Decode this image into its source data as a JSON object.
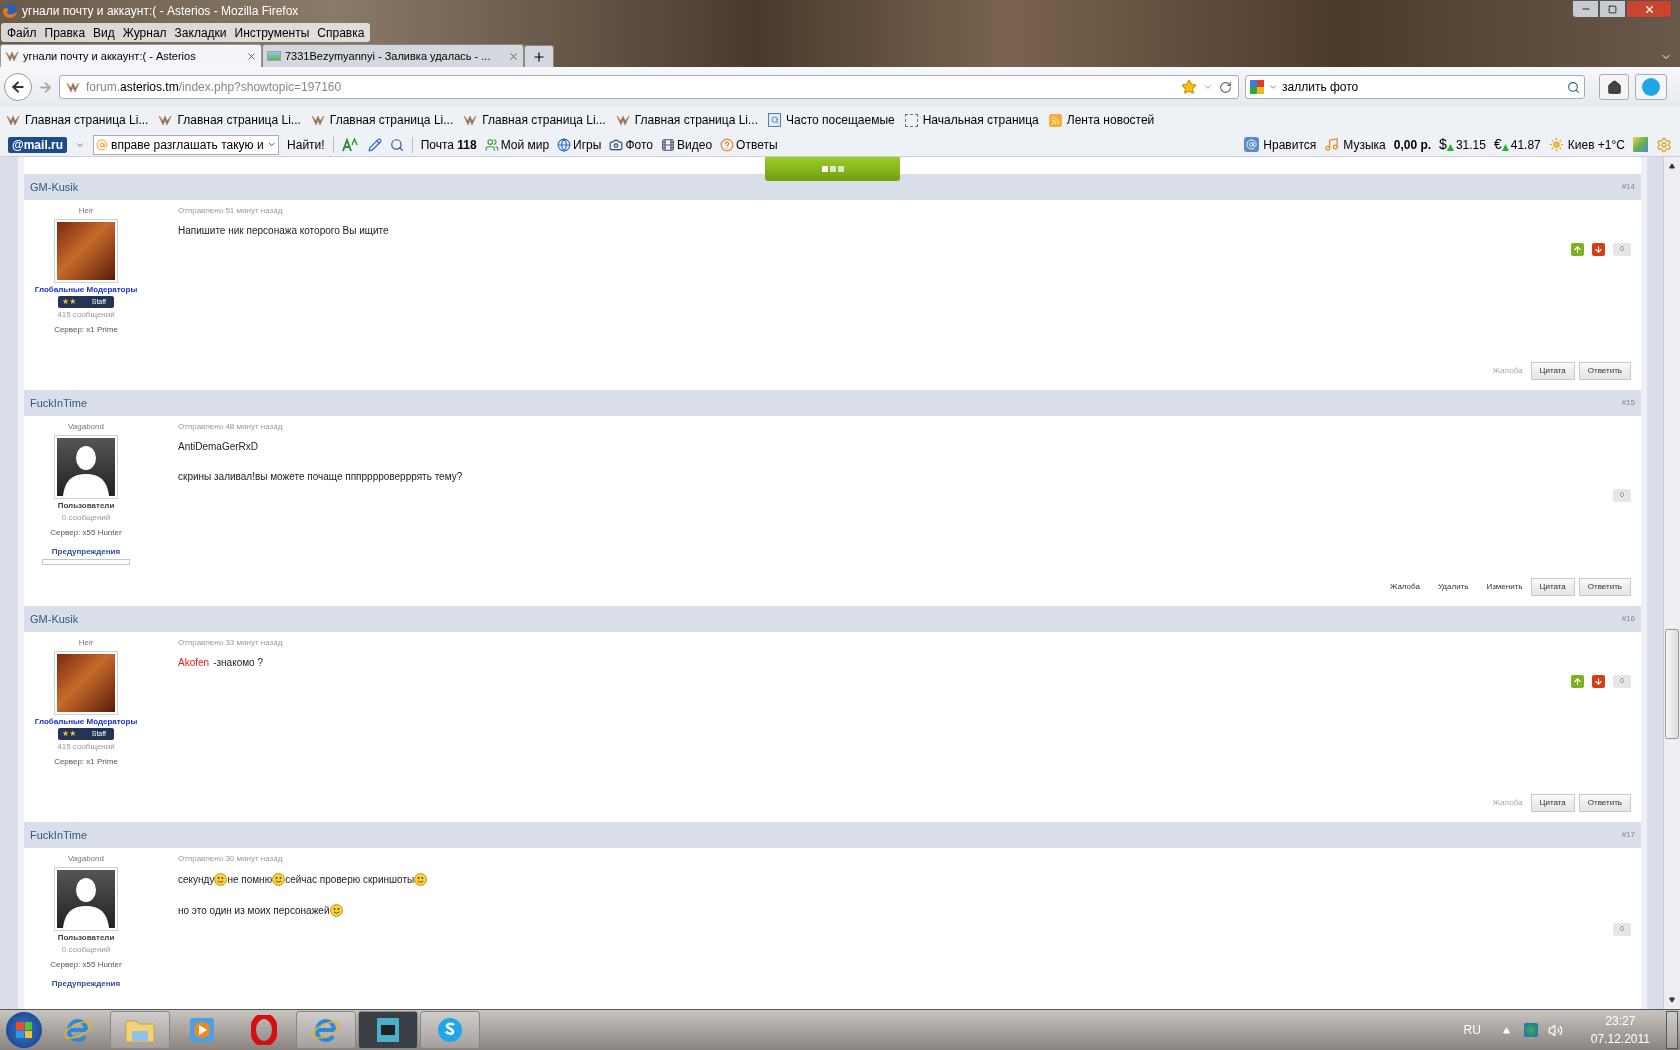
{
  "window": {
    "title": "угнали почту и аккаунт:( - Asterios - Mozilla Firefox"
  },
  "menu": [
    "Файл",
    "Правка",
    "Вид",
    "Журнал",
    "Закладки",
    "Инструменты",
    "Справка"
  ],
  "tabs": [
    {
      "label": "угнали почту и аккаунт:( - Asterios",
      "selected": true
    },
    {
      "label": "7331Bezymyannyi - Заливка удалась - ...",
      "selected": false
    }
  ],
  "address": {
    "value": "forum.**asterios.tm**/index.php?showtopic=197160"
  },
  "search": {
    "value": "заллить фото"
  },
  "bookmarks": [
    {
      "kind": "site",
      "label": "Главная страница Li..."
    },
    {
      "kind": "site",
      "label": "Главная страница Li..."
    },
    {
      "kind": "site",
      "label": "Главная страница Li..."
    },
    {
      "kind": "site",
      "label": "Главная страница Li..."
    },
    {
      "kind": "site",
      "label": "Главная страница Li..."
    },
    {
      "kind": "frequent",
      "label": "Часто посещаемые"
    },
    {
      "kind": "blank",
      "label": "Начальная страница"
    },
    {
      "kind": "feed",
      "label": "Лента новостей"
    }
  ],
  "mail_toolbar": {
    "logo": "@mail.ru",
    "search_value": "вправе разглашать такую и",
    "find_button": "Найти!",
    "links": [
      {
        "kind": "mail",
        "label": "Почта **118**"
      },
      {
        "kind": "world",
        "label": "Мой мир"
      },
      {
        "kind": "games",
        "label": "Игры"
      },
      {
        "kind": "photo",
        "label": "Фото"
      },
      {
        "kind": "video",
        "label": "Видео"
      },
      {
        "kind": "answers",
        "label": "Ответы"
      }
    ],
    "widgets": [
      {
        "kind": "like",
        "label": "Нравится"
      },
      {
        "kind": "music",
        "label": "Музыка"
      },
      {
        "kind": "balance",
        "label": "0,00 р."
      },
      {
        "kind": "rate",
        "symbol": "$",
        "label": "31.15"
      },
      {
        "kind": "rate",
        "symbol": "€",
        "label": "41.87"
      },
      {
        "kind": "weather",
        "label": "Киев +1°C"
      }
    ]
  },
  "posts": [
    {
      "author": "GM-Kusik",
      "number": "#14",
      "rank": "Heir",
      "avatar": {
        "kind": "photo"
      },
      "group": {
        "kind": "moderator",
        "text": "Глобальные Модераторы"
      },
      "badge": {
        "marks": "★★",
        "label": "Staff"
      },
      "post_count": "415 сообщений",
      "server": "Сервер: x1 Prime",
      "date": "Отправлено 51 минут назад",
      "lines": [
        [
          {
            "kind": "text",
            "text": "Напишите ник персонажа которого Вы ищите"
          }
        ]
      ],
      "vote_buttons": true,
      "rating": "0",
      "actions": [
        {
          "kind": "link",
          "label": "Жалоба",
          "disabled": true
        },
        {
          "kind": "button",
          "label": "Цитата",
          "disabled": false
        },
        {
          "kind": "button",
          "label": "Ответить",
          "disabled": false
        }
      ]
    },
    {
      "author": "FuckInTime",
      "number": "#15",
      "rank": "Vagabond",
      "avatar": {
        "kind": "silhouette"
      },
      "group": {
        "kind": "user",
        "text": "Пользователи"
      },
      "post_count": "0 сообщений",
      "server": "Сервер: x55 Hunter",
      "warnings": {
        "label": "Предупреждения",
        "level": 0
      },
      "date": "Отправлено 48 минут назад",
      "lines": [
        [
          {
            "kind": "text",
            "text": "AntiDemaGerRxD"
          }
        ],
        [
          {
            "kind": "text",
            "text": "скрины заливал!вы можете почаще пппрррроверррять тему?"
          }
        ]
      ],
      "vote_buttons": false,
      "rating": "0",
      "actions": [
        {
          "kind": "link",
          "label": "Жалоба",
          "disabled": false
        },
        {
          "kind": "link",
          "label": "Удалить",
          "disabled": false
        },
        {
          "kind": "link",
          "label": "Изменить",
          "disabled": false
        },
        {
          "kind": "button",
          "label": "Цитата",
          "disabled": false
        },
        {
          "kind": "button",
          "label": "Ответить",
          "disabled": false
        }
      ]
    },
    {
      "author": "GM-Kusik",
      "number": "#16",
      "rank": "Heir",
      "avatar": {
        "kind": "photo"
      },
      "group": {
        "kind": "moderator",
        "text": "Глобальные Модераторы"
      },
      "badge": {
        "marks": "★★",
        "label": "Staff"
      },
      "post_count": "415 сообщений",
      "server": "Сервер: x1 Prime",
      "date": "Отправлено 33 минут назад",
      "lines": [
        [
          {
            "kind": "mention",
            "text": "Akofen"
          },
          {
            "kind": "text",
            "text": "-знакомо ?"
          }
        ]
      ],
      "vote_buttons": true,
      "rating": "0",
      "actions": [
        {
          "kind": "link",
          "label": "Жалоба",
          "disabled": true
        },
        {
          "kind": "button",
          "label": "Цитата",
          "disabled": false
        },
        {
          "kind": "button",
          "label": "Ответить",
          "disabled": false
        }
      ]
    },
    {
      "author": "FuckInTime",
      "number": "#17",
      "rank": "Vagabond",
      "avatar": {
        "kind": "silhouette"
      },
      "group": {
        "kind": "user",
        "text": "Пользователи"
      },
      "post_count": "0 сообщений",
      "server": "Сервер: x55 Hunter",
      "warnings": {
        "label": "Предупреждения"
      },
      "date": "Отправлено 30 минут назад",
      "lines": [
        [
          {
            "kind": "text",
            "text": "секунду"
          },
          {
            "kind": "smiley"
          },
          {
            "kind": "text",
            "text": "не помню"
          },
          {
            "kind": "smiley"
          },
          {
            "kind": "text",
            "text": "сейчас проверю скриншоты"
          },
          {
            "kind": "smiley"
          }
        ],
        [
          {
            "kind": "text",
            "text": "но это один из моих персонажей"
          },
          {
            "kind": "smiley"
          }
        ]
      ],
      "vote_buttons": false,
      "rating": "0"
    }
  ],
  "taskbar": {
    "apps": [
      {
        "kind": "ie",
        "running": false,
        "selected": false
      },
      {
        "kind": "folder",
        "running": true,
        "selected": false
      },
      {
        "kind": "player",
        "running": false,
        "selected": false
      },
      {
        "kind": "opera",
        "running": false,
        "selected": false
      },
      {
        "kind": "ie",
        "running": true,
        "selected": false
      },
      {
        "kind": "film",
        "running": true,
        "selected": true
      },
      {
        "kind": "skype",
        "running": true,
        "selected": false
      }
    ],
    "language": "RU",
    "time": "23:27",
    "date": "07.12.2011"
  }
}
